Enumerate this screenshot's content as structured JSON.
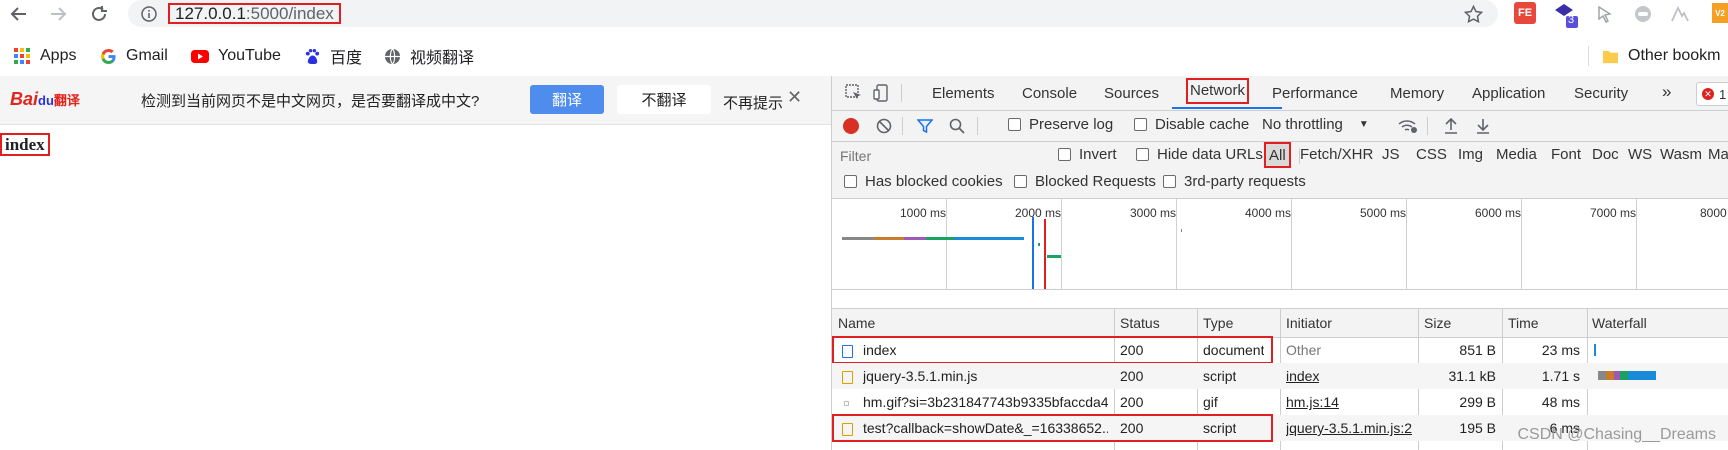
{
  "browser": {
    "url_host": "127.0.0.1",
    "url_rest": ":5000/index",
    "bookmarks": [
      {
        "label": "Apps",
        "icon": "apps-grid-icon"
      },
      {
        "label": "Gmail",
        "icon": "google-icon"
      },
      {
        "label": "YouTube",
        "icon": "youtube-icon"
      },
      {
        "label": "百度",
        "icon": "baidu-paw-icon"
      },
      {
        "label": "视频翻译",
        "icon": "globe-icon"
      }
    ],
    "other_bookmarks": "Other bookm",
    "extension_badge": "3",
    "extension_fe": "FE"
  },
  "baidu_bar": {
    "logo_text": "Bai",
    "logo_du": "du",
    "logo_suffix": "翻译",
    "message": "检测到当前网页不是中文网页，是否要翻译成中文?",
    "translate": "翻译",
    "no_translate": "不翻译",
    "never": "不再提示",
    "close": "✕"
  },
  "page": {
    "heading": "index"
  },
  "devtools": {
    "tabs": [
      "Elements",
      "Console",
      "Sources",
      "Network",
      "Performance",
      "Memory",
      "Application",
      "Security"
    ],
    "active_tab": "Network",
    "more_tabs": "»",
    "error_count": "1",
    "preserve_log": "Preserve log",
    "disable_cache": "Disable cache",
    "throttling": "No throttling",
    "filter_placeholder": "Filter",
    "invert": "Invert",
    "hide_data_urls": "Hide data URLs",
    "types": [
      "All",
      "Fetch/XHR",
      "JS",
      "CSS",
      "Img",
      "Media",
      "Font",
      "Doc",
      "WS",
      "Wasm",
      "Ma"
    ],
    "has_blocked_cookies": "Has blocked cookies",
    "blocked_requests": "Blocked Requests",
    "third_party": "3rd-party requests",
    "timeline_ticks": [
      "1000 ms",
      "2000 ms",
      "3000 ms",
      "4000 ms",
      "5000 ms",
      "6000 ms",
      "7000 ms",
      "8000"
    ],
    "columns": [
      "Name",
      "Status",
      "Type",
      "Initiator",
      "Size",
      "Time",
      "Waterfall"
    ],
    "rows": [
      {
        "name": "index",
        "status": "200",
        "type": "document",
        "initiator": "Other",
        "size": "851 B",
        "time": "23 ms",
        "icon": "document-icon"
      },
      {
        "name": "jquery-3.5.1.min.js",
        "status": "200",
        "type": "script",
        "initiator": "index",
        "size": "31.1 kB",
        "time": "1.71 s",
        "icon": "script-icon"
      },
      {
        "name": "hm.gif?si=3b231847743b9335bfaccda4...",
        "status": "200",
        "type": "gif",
        "initiator": "hm.js:14",
        "size": "299 B",
        "time": "48 ms",
        "icon": "image-icon"
      },
      {
        "name": "test?callback=showDate&_=16338652...",
        "status": "200",
        "type": "script",
        "initiator": "jquery-3.5.1.min.js:2",
        "size": "195 B",
        "time": "6 ms",
        "icon": "script-icon"
      }
    ]
  },
  "watermark": "CSDN @Chasing__Dreams"
}
